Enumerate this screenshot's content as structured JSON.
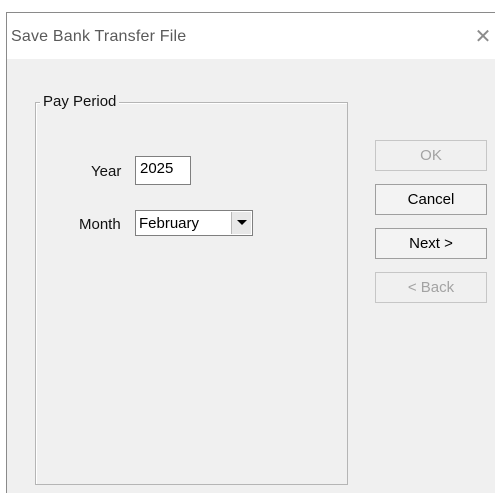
{
  "window": {
    "title": "Save Bank Transfer File",
    "close_glyph": "✕"
  },
  "pay_period": {
    "group_label": "Pay Period",
    "year_label": "Year",
    "year_value": "2025",
    "month_label": "Month",
    "month_value": "February"
  },
  "buttons": {
    "ok": "OK",
    "cancel": "Cancel",
    "next": "Next >",
    "back": "< Back"
  }
}
